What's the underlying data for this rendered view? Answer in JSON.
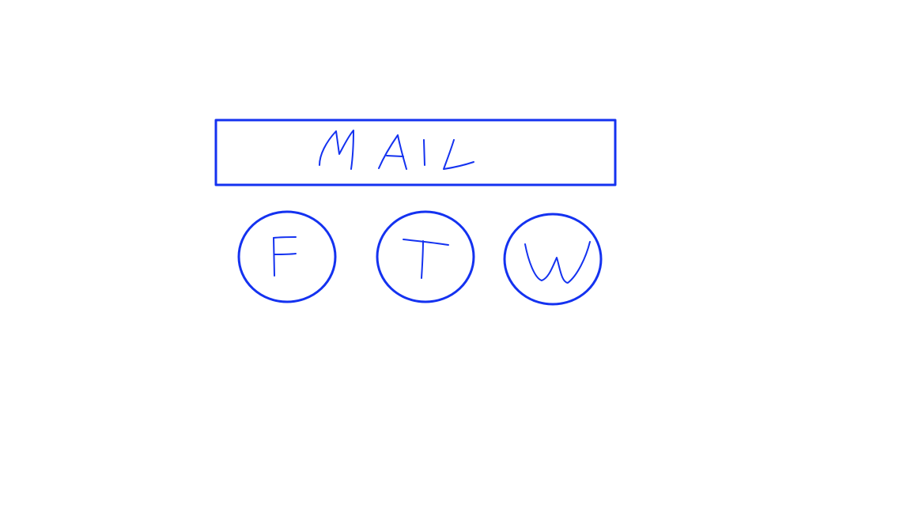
{
  "ink_color": "#1432f0",
  "background_color": "#ffffff",
  "mail_field": {
    "label": "MAIL"
  },
  "social_buttons": [
    {
      "label": "F"
    },
    {
      "label": "T"
    },
    {
      "label": "W"
    }
  ]
}
